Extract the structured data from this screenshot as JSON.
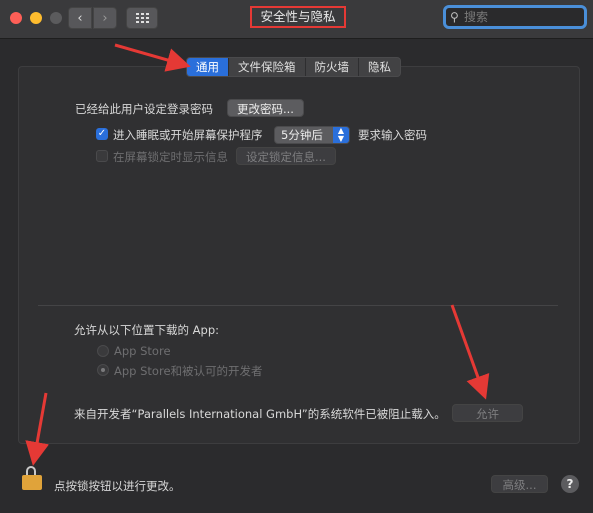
{
  "window": {
    "title": "安全性与隐私",
    "search_placeholder": "搜索"
  },
  "tabs": [
    {
      "label": "通用",
      "active": true
    },
    {
      "label": "文件保险箱",
      "active": false
    },
    {
      "label": "防火墙",
      "active": false
    },
    {
      "label": "隐私",
      "active": false
    }
  ],
  "general": {
    "password_label": "已经给此用户设定登录密码",
    "change_password_button": "更改密码...",
    "require_password_label": "进入睡眠或开始屏幕保护程序",
    "require_password_checked": true,
    "require_password_delay": "5分钟后",
    "require_password_suffix": "要求输入密码",
    "show_message_label": "在屏幕锁定时显示信息",
    "show_message_checked": false,
    "set_lock_message_button": "设定锁定信息..."
  },
  "downloads": {
    "heading": "允许从以下位置下载的 App:",
    "options": [
      {
        "label": "App Store",
        "selected": false
      },
      {
        "label": "App Store和被认可的开发者",
        "selected": true
      }
    ],
    "blocked_message": "来自开发者“Parallels International GmbH”的系统软件已被阻止载入。",
    "allow_button": "允许"
  },
  "footer": {
    "lock_text": "点按锁按钮以进行更改。",
    "advanced_button": "高级...",
    "help_button": "?"
  },
  "colors": {
    "accent": "#2a6fdb",
    "annotation": "#e53935",
    "lock": "#e0a33a"
  }
}
